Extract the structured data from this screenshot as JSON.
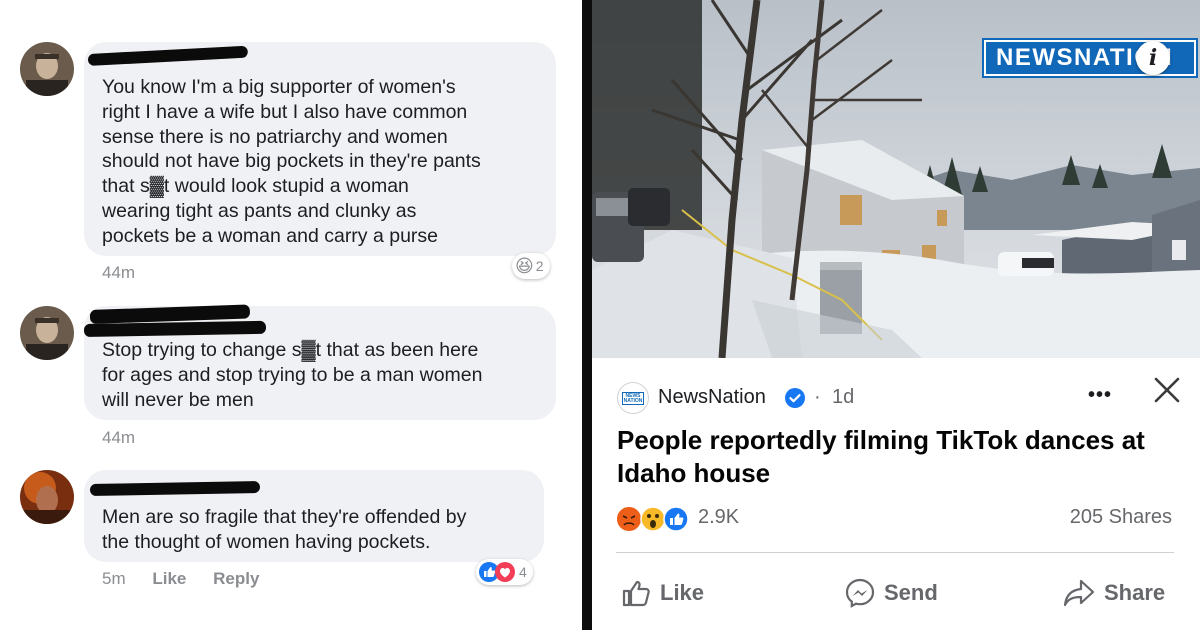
{
  "comments": [
    {
      "text": "You know I'm a big supporter of women's\nright I have a wife but I also have common\nsense there is no patriarchy and women\nshould not have big pockets in they're pants\nthat s▓t would look stupid a woman\nwearing tight as pants and clunky as\npockets be a woman and carry a purse",
      "time": "44m",
      "reaction_emoji": "😆",
      "reaction_count": "2"
    },
    {
      "text": "Stop trying to change s▓t that as been here\nfor ages and stop trying to be a man women\nwill never be men",
      "time": "44m"
    },
    {
      "text": "Men are so fragile that they're offended by\nthe thought of women having pockets.",
      "time": "5m",
      "like_label": "Like",
      "reply_label": "Reply",
      "reaction_count": "4"
    }
  ],
  "post": {
    "logo_text": "NEWSNATION",
    "page_name": "NewsNation",
    "separator": "·",
    "time": "1d",
    "more_label": "•••",
    "headline": "People reportedly filming TikTok dances at Idaho house",
    "reaction_count": "2.9K",
    "shares": "205 Shares",
    "actions": {
      "like": "Like",
      "send": "Send",
      "share": "Share"
    }
  },
  "icons": {
    "verified": "verified-badge-icon",
    "close": "close-icon",
    "like": "thumbs-up-icon",
    "send": "messenger-icon",
    "share": "share-arrow-icon",
    "info": "info-icon"
  },
  "colors": {
    "facebook_blue": "#1877f2",
    "newsnation_blue": "#1167b8",
    "love_red": "#f33e58",
    "bubble_gray": "#f0f1f4",
    "meta_gray": "#8a8d91"
  }
}
